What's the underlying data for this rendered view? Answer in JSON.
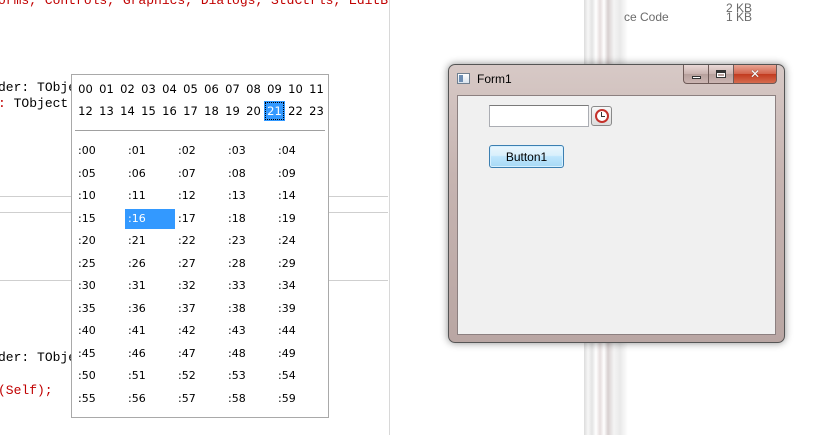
{
  "editor": {
    "top_line": "orms, Controls, Graphics, Dialogs, StdCtrls, EditBtn, TimeEditing;",
    "sender_line_1_label": "der: ",
    "sender_line_1_type": "TObje",
    "sender_line_2_label": ": ",
    "sender_line_2_type": "TObject",
    "sender_line_3_label": "der: ",
    "sender_line_3_type": "TObje",
    "self_call": "(Self);"
  },
  "explorer": {
    "type_partial": "ce Code",
    "size_value": "1 KB",
    "size_value_top": "2 KB"
  },
  "time_popup": {
    "hours_row1": [
      "00",
      "01",
      "02",
      "03",
      "04",
      "05",
      "06",
      "07",
      "08",
      "09",
      "10",
      "11"
    ],
    "hours_row2": [
      "12",
      "13",
      "14",
      "15",
      "16",
      "17",
      "18",
      "19",
      "20",
      "21",
      "22",
      "23"
    ],
    "selected_hour": "21",
    "minutes": [
      [
        ":00",
        ":01",
        ":02",
        ":03",
        ":04"
      ],
      [
        ":05",
        ":06",
        ":07",
        ":08",
        ":09"
      ],
      [
        ":10",
        ":11",
        ":12",
        ":13",
        ":14"
      ],
      [
        ":15",
        ":16",
        ":17",
        ":18",
        ":19"
      ],
      [
        ":20",
        ":21",
        ":22",
        ":23",
        ":24"
      ],
      [
        ":25",
        ":26",
        ":27",
        ":28",
        ":29"
      ],
      [
        ":30",
        ":31",
        ":32",
        ":33",
        ":34"
      ],
      [
        ":35",
        ":36",
        ":37",
        ":38",
        ":39"
      ],
      [
        ":40",
        ":41",
        ":42",
        ":43",
        ":44"
      ],
      [
        ":45",
        ":46",
        ":47",
        ":48",
        ":49"
      ],
      [
        ":50",
        ":51",
        ":52",
        ":53",
        ":54"
      ],
      [
        ":55",
        ":56",
        ":57",
        ":58",
        ":59"
      ]
    ],
    "selected_minute": ":16"
  },
  "window": {
    "title": "Form1",
    "close_glyph": "✕",
    "time_input_value": "",
    "button1_label": "Button1"
  },
  "colors": {
    "selection": "#3399ff",
    "code_red": "#c00000"
  }
}
